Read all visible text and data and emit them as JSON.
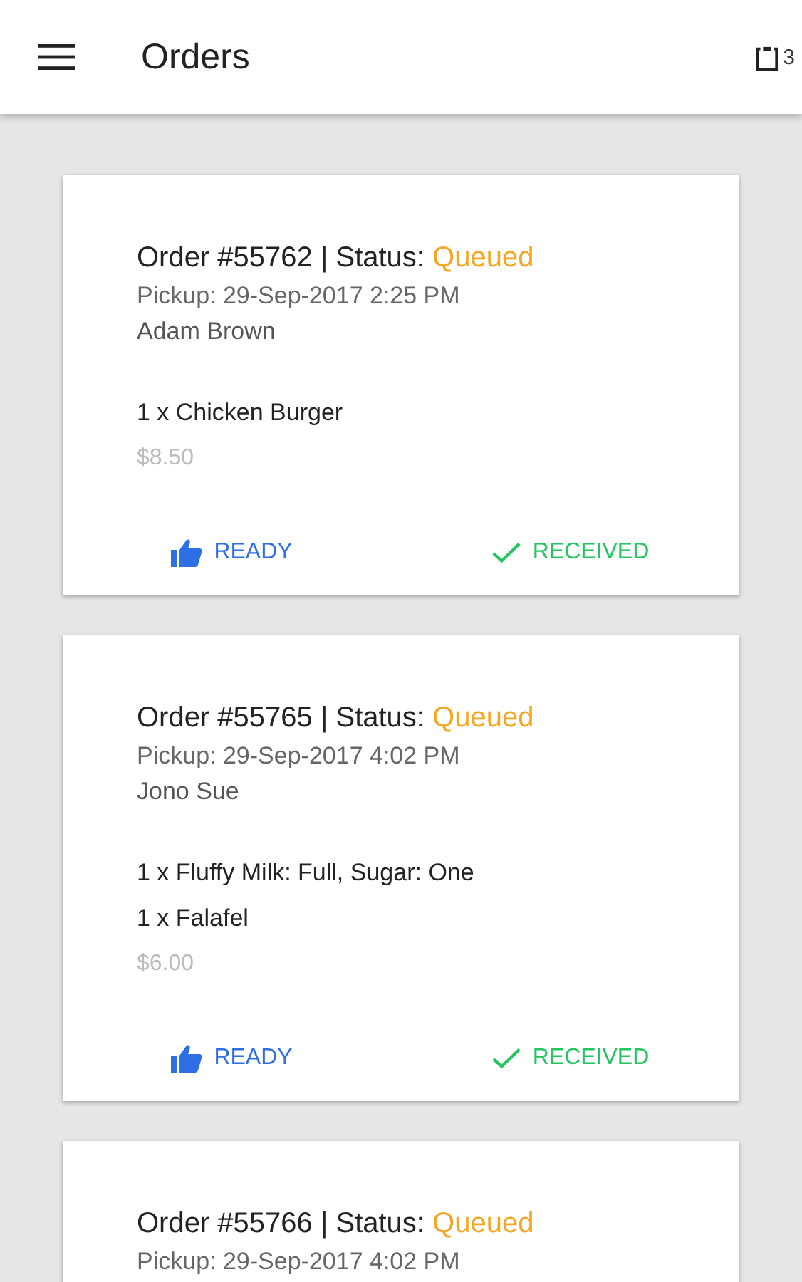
{
  "app_bar": {
    "title": "Orders",
    "cart_count": "3"
  },
  "orders": [
    {
      "heading": "Order #55762 | Status:",
      "status": "Queued",
      "pickup": "Pickup: 29-Sep-2017 2:25 PM",
      "customer": "Adam Brown",
      "items": [
        "1 x Chicken Burger"
      ],
      "price": "$8.50",
      "actions": [
        {
          "kind": "ready",
          "label": "READY"
        },
        {
          "kind": "received",
          "label": "RECEIVED"
        }
      ]
    },
    {
      "heading": "Order #55765 | Status:",
      "status": "Queued",
      "pickup": "Pickup: 29-Sep-2017 4:02 PM",
      "customer": "Jono Sue",
      "items": [
        "1 x Fluffy Milk: Full, Sugar: One",
        "1 x Falafel"
      ],
      "price": "$6.00",
      "actions": [
        {
          "kind": "ready",
          "label": "READY"
        },
        {
          "kind": "received",
          "label": "RECEIVED"
        }
      ]
    },
    {
      "heading": "Order #55766 | Status:",
      "status": "Queued",
      "pickup": "Pickup: 29-Sep-2017 4:02 PM"
    }
  ]
}
